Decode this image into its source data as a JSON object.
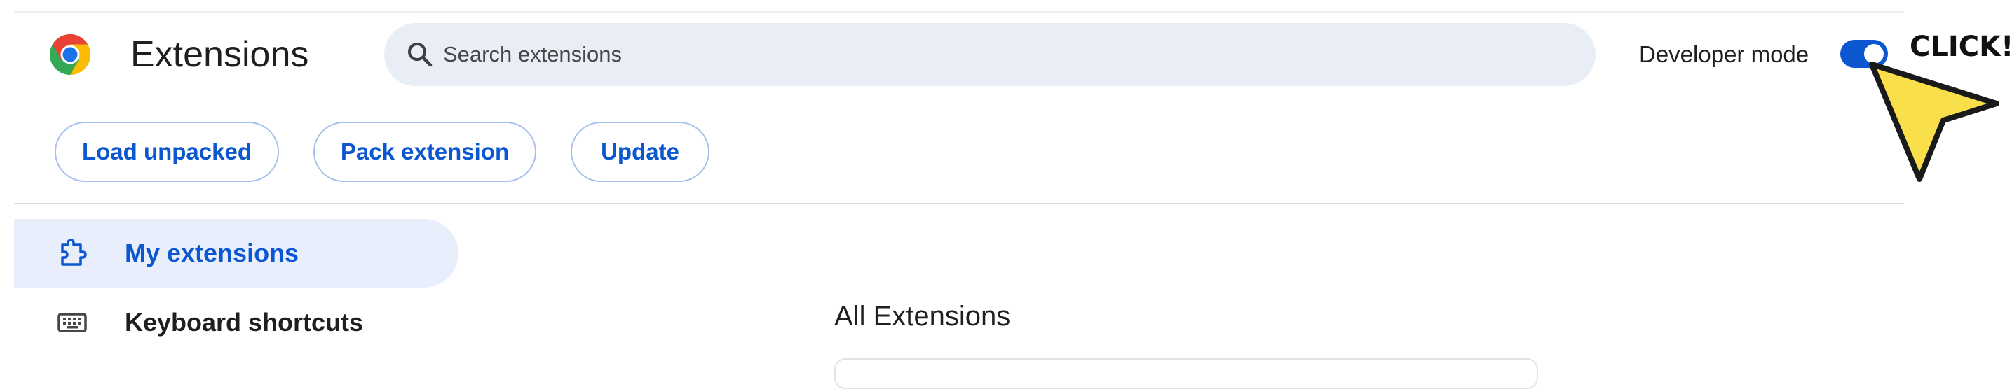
{
  "header": {
    "title": "Extensions",
    "search": {
      "placeholder": "Search extensions",
      "value": ""
    },
    "developer_mode": {
      "label": "Developer mode",
      "enabled": true
    }
  },
  "toolbar": {
    "load_unpacked": "Load unpacked",
    "pack_extension": "Pack extension",
    "update": "Update"
  },
  "sidebar": {
    "items": [
      {
        "label": "My extensions",
        "icon": "extension-puzzle-icon",
        "selected": true
      },
      {
        "label": "Keyboard shortcuts",
        "icon": "keyboard-icon",
        "selected": false
      }
    ]
  },
  "main": {
    "section_title": "All Extensions"
  },
  "annotation": {
    "text": "CLICK!"
  },
  "colors": {
    "accent": "#0b57d0",
    "search_bg": "#e9edf6",
    "selected_nav_bg": "#e8eefc",
    "cursor_fill": "#f9df4a"
  }
}
